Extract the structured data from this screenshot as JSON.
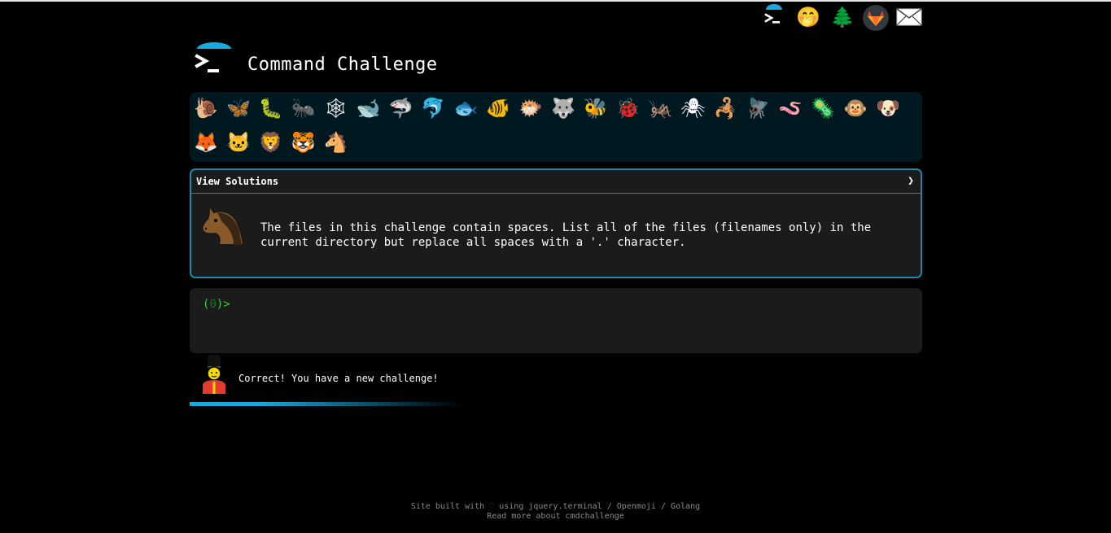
{
  "app": {
    "title": "Command Challenge"
  },
  "top_icons": [
    {
      "name": "terminal-icon",
      "glyph": ""
    },
    {
      "name": "hand-over-mouth-icon",
      "glyph": "🤭"
    },
    {
      "name": "tree-icon",
      "glyph": "🌲"
    },
    {
      "name": "gitlab-icon",
      "glyph": "🦊"
    },
    {
      "name": "envelope-icon",
      "glyph": "✉"
    }
  ],
  "animals": [
    {
      "name": "snail-icon",
      "glyph": "🐌"
    },
    {
      "name": "butterfly-icon",
      "glyph": "🦋"
    },
    {
      "name": "caterpillar-icon",
      "glyph": "🐛"
    },
    {
      "name": "ant-icon",
      "glyph": "🐜"
    },
    {
      "name": "spider-web-icon",
      "glyph": "🕸"
    },
    {
      "name": "whale-icon",
      "glyph": "🐋"
    },
    {
      "name": "shark-icon",
      "glyph": "🦈"
    },
    {
      "name": "dolphin-icon",
      "glyph": "🐬"
    },
    {
      "name": "fish-icon",
      "glyph": "🐟"
    },
    {
      "name": "tropical-fish-icon",
      "glyph": "🐠"
    },
    {
      "name": "blowfish-icon",
      "glyph": "🐡"
    },
    {
      "name": "wolf-icon",
      "glyph": "🐺"
    },
    {
      "name": "bee-icon",
      "glyph": "🐝"
    },
    {
      "name": "lady-beetle-icon",
      "glyph": "🐞"
    },
    {
      "name": "cricket-icon",
      "glyph": "🦗"
    },
    {
      "name": "spider-icon",
      "glyph": "🕷"
    },
    {
      "name": "scorpion-icon",
      "glyph": "🦂"
    },
    {
      "name": "fly-icon",
      "glyph": "🪰"
    },
    {
      "name": "worm-icon",
      "glyph": "🪱"
    },
    {
      "name": "microbe-icon",
      "glyph": "🦠"
    },
    {
      "name": "monkey-icon",
      "glyph": "🐵"
    },
    {
      "name": "dog-icon",
      "glyph": "🐶"
    },
    {
      "name": "fox-icon",
      "glyph": "🦊"
    },
    {
      "name": "cat-icon",
      "glyph": "🐱"
    },
    {
      "name": "lion-icon",
      "glyph": "🦁"
    },
    {
      "name": "tiger-icon",
      "glyph": "🐯"
    },
    {
      "name": "horse-icon",
      "glyph": "🐴"
    }
  ],
  "challenge": {
    "header": "View Solutions",
    "chevron": "❯",
    "text": "The files in this challenge contain spaces. List all of the files (filenames only) in the current directory but replace all spaces with a '.' character."
  },
  "terminal": {
    "prompt_open": "(",
    "prompt_count": "0",
    "prompt_close": ")>"
  },
  "result": {
    "message": "Correct! You have a new challenge!"
  },
  "progress": 0.6,
  "footer": {
    "line1_prefix": "Site built with",
    "heart": "♡",
    "using": "using",
    "link_jquery": "jquery.terminal",
    "sep1": "/",
    "link_openmoji": "Openmoji",
    "sep2": "/",
    "link_golang": "Golang",
    "line2": "Read more about cmdchallenge"
  },
  "colors": {
    "accent": "#1d8aa8",
    "prompt": "#2bd32b",
    "panel": "#1b1b1b",
    "animal_bar": "#001820"
  }
}
